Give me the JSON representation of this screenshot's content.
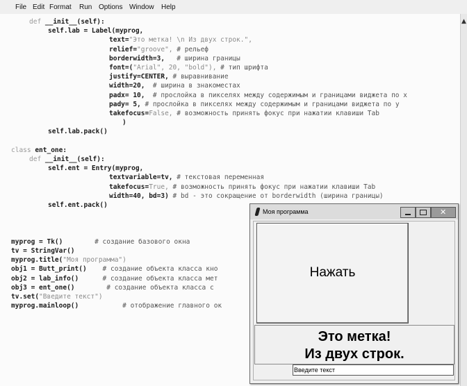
{
  "menu": [
    "File",
    "Edit",
    "Format",
    "Run",
    "Options",
    "Window",
    "Help"
  ],
  "code_lines": [
    {
      "kw": "def",
      "text": " __init__(self):"
    },
    {
      "text": "self.lab = Label(myprog,"
    },
    {
      "text": "text=",
      "str": "\"Это метка! \\n Из двух строк.\","
    },
    {
      "text": "relief=",
      "str": "\"groove\",",
      "cmt": " # рельеф"
    },
    {
      "text": "borderwidth=3,",
      "cmt": "   # ширина границы"
    },
    {
      "text": "font=(",
      "str": "\"Arial\", 20, \"bold\"),",
      "cmt": " # тип шрифта"
    },
    {
      "text": "justify=CENTER,",
      "cmt": " # выравнивание"
    },
    {
      "text": "width=20,",
      "cmt": "  # ширина в знакоместах"
    },
    {
      "text": "padx= 10,",
      "cmt": "  # прослойка в пикселях между содержимым и границами виджета по x"
    },
    {
      "text": "pady= 5,",
      "cmt": " # прослойка в пикселях между содержимым и границами виджета по y"
    },
    {
      "text": "takefocus=",
      "str": "False,",
      "cmt": " # возможность принять фокус при нажатии клавиши Tab"
    },
    {
      "text": ")"
    },
    {
      "text": "self.lab.pack()"
    },
    {
      "text": ""
    },
    {
      "kw": "class",
      "text": " ent_one:"
    },
    {
      "kw": "def",
      "text": " __init__(self):"
    },
    {
      "text": "self.ent = Entry(myprog,"
    },
    {
      "text": "textvariable=tv,",
      "cmt": " # текстовая переменная"
    },
    {
      "text": "takefocus=",
      "str": "True,",
      "cmt": " # возможность принять фокус при нажатии клавиши Tab"
    },
    {
      "text": "width=40, bd=3)",
      "cmt": " # bd - это сокращение от borderwidth (ширина границы)"
    },
    {
      "text": "self.ent.pack()"
    },
    {
      "text": ""
    },
    {
      "text": ""
    },
    {
      "text": ""
    },
    {
      "text": "myprog = Tk()",
      "cmt": "        # создание базового окна"
    },
    {
      "text": "tv = StringVar()"
    },
    {
      "text": "myprog.title(",
      "str": "\"Моя программа\")"
    },
    {
      "text": "obj1 = Butt_print()",
      "cmt": "    # создание объекта класса кно"
    },
    {
      "text": "obj2 = lab_info()",
      "cmt": "      # создание объекта класса мет"
    },
    {
      "text": "obj3 = ent_one()",
      "cmt": "        # создание объекта класса с"
    },
    {
      "text": "tv.set(",
      "str": "\"Введите текст\")"
    },
    {
      "text": "myprog.mainloop()",
      "cmt": "           # отображение главного ок"
    }
  ],
  "tk_window": {
    "title": "Моя программа",
    "button_label": "Нажать",
    "label_text": "Это метка!\nИз двух строк.",
    "entry_value": "Введите текст"
  }
}
